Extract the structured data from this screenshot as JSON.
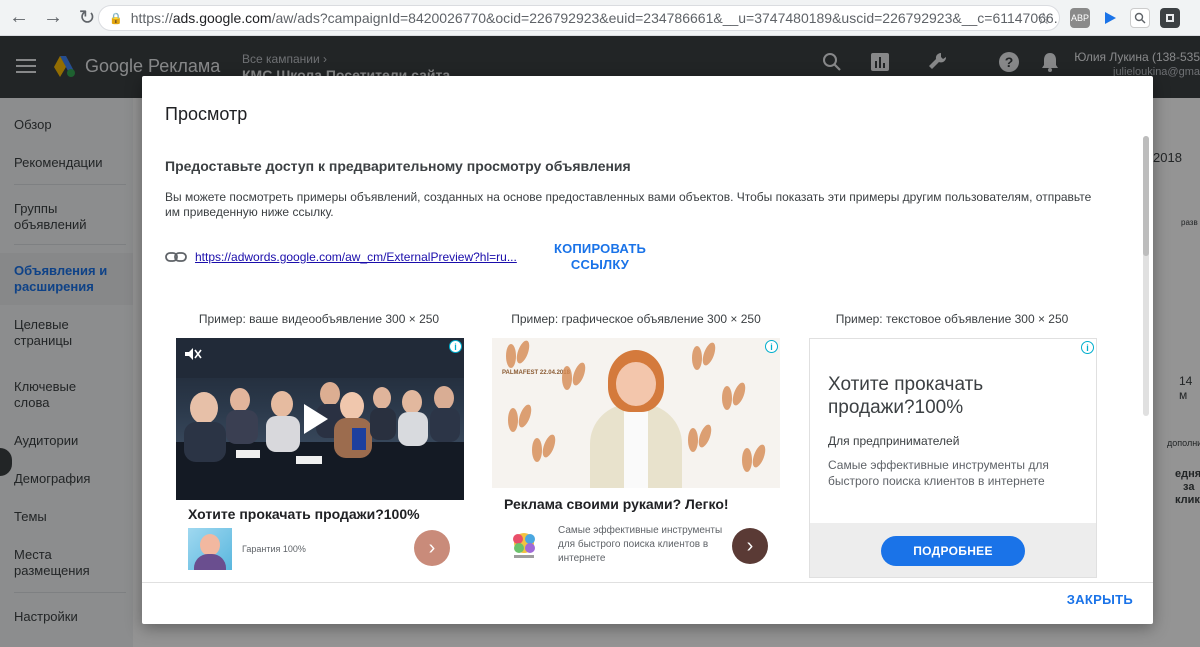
{
  "browser": {
    "url_prefix": "https://",
    "url_host": "ads.google.com",
    "url_rest": "/aw/ads?campaignId=8420026770&ocid=226792923&euid=234786661&__u=3747480189&uscid=226792923&__c=61147066...",
    "ext_abp": "ABP"
  },
  "header": {
    "logo_text": "Google Реклама",
    "crumb_small": "Все кампании  ›",
    "crumb_big": "КМС Школа Посетители сайта",
    "user_name": "Юлия Лукина (138-535",
    "user_email": "julieloukina@gma"
  },
  "sidebar": {
    "items": [
      {
        "label": "Обзор"
      },
      {
        "label": "Рекомендации"
      },
      {
        "label": "Группы объявлений"
      },
      {
        "label": "Объявления и расширения"
      },
      {
        "label": "Целевые страницы"
      },
      {
        "label": "Ключевые слова"
      },
      {
        "label": "Аудитории"
      },
      {
        "label": "Демография"
      },
      {
        "label": "Темы"
      },
      {
        "label": "Места размещения"
      },
      {
        "label": "Настройки"
      }
    ]
  },
  "background": {
    "year": "2018",
    "date": "14 м",
    "col1": "разв",
    "col2": "дополнител",
    "col3": "едняя",
    "col4": "за",
    "col5": "клик"
  },
  "modal": {
    "title": "Просмотр",
    "section_heading": "Предоставьте доступ к предварительному просмотру объявления",
    "description": "Вы можете посмотреть примеры объявлений, созданных на основе предоставленных вами объектов. Чтобы показать эти примеры другим пользователям, отправьте им приведенную ниже ссылку.",
    "preview_link": "https://adwords.google.com/aw_cm/ExternalPreview?hl=ru...",
    "copy_link_label": "КОПИРОВАТЬ ССЫЛКУ",
    "close_label": "ЗАКРЫТЬ"
  },
  "ads": {
    "video": {
      "caption": "Пример: ваше видеообъявление 300 × 250",
      "headline": "Хотите прокачать продажи?100%",
      "guarantee": "Гарантия 100%",
      "arrow_color": "#c98b7a"
    },
    "image": {
      "caption": "Пример: графическое объявление 300 × 250",
      "headline": "Реклама своими руками? Легко!",
      "body": "Самые эффективные инструменты для быстрого поиска клиентов в интернете",
      "palm_label": "PALMAFEST 22.04.2018",
      "arrow_color": "#5a3a35"
    },
    "text": {
      "caption": "Пример: текстовое объявление 300 × 250",
      "headline": "Хотите прокачать продажи?100%",
      "subtitle": "Для предпринимателей",
      "body": "Самые эффективные инструменты для быстрого поиска клиентов в интернете",
      "button_label": "ПОДРОБНЕЕ"
    },
    "info_glyph": "i"
  },
  "colors": {
    "accent": "#1a73e8",
    "header_bg": "#3c4043"
  }
}
